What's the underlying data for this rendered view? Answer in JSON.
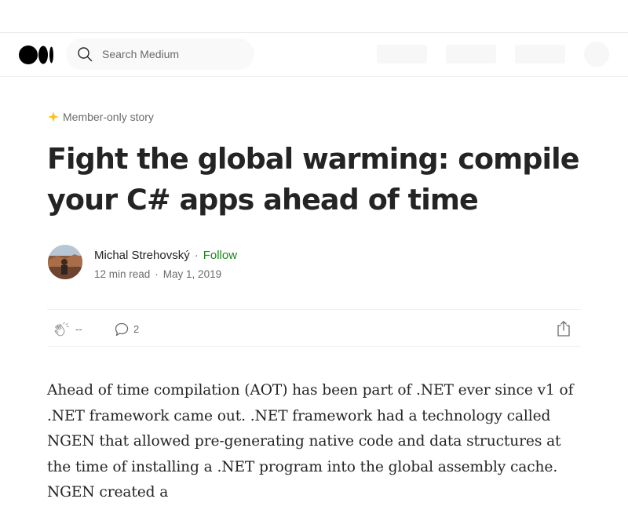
{
  "navbar": {
    "logo": "medium-logo",
    "search": {
      "placeholder": "Search Medium",
      "icon": "search-icon"
    }
  },
  "article": {
    "badge": {
      "icon": "star-icon",
      "label": "Member-only story",
      "color": "#ffc017"
    },
    "title": "Fight the global warming: compile your C# apps ahead of time",
    "author": {
      "name": "Michal Strehovský",
      "separator": "·",
      "follow_label": "Follow",
      "follow_color": "#1a8917"
    },
    "meta": {
      "read_time": "12 min read",
      "separator": "·",
      "date": "May 1, 2019"
    },
    "actions": {
      "clap_icon": "clap-icon",
      "clap_count": "--",
      "responses_icon": "comment-icon",
      "responses_count": "2",
      "share_icon": "share-icon"
    },
    "body": "Ahead of time compilation (AOT) has been part of .NET ever since v1 of .NET framework came out. .NET framework had a technology called NGEN that allowed pre-generating native code and data structures at the time of installing a .NET program into the global assembly cache. NGEN created a"
  }
}
